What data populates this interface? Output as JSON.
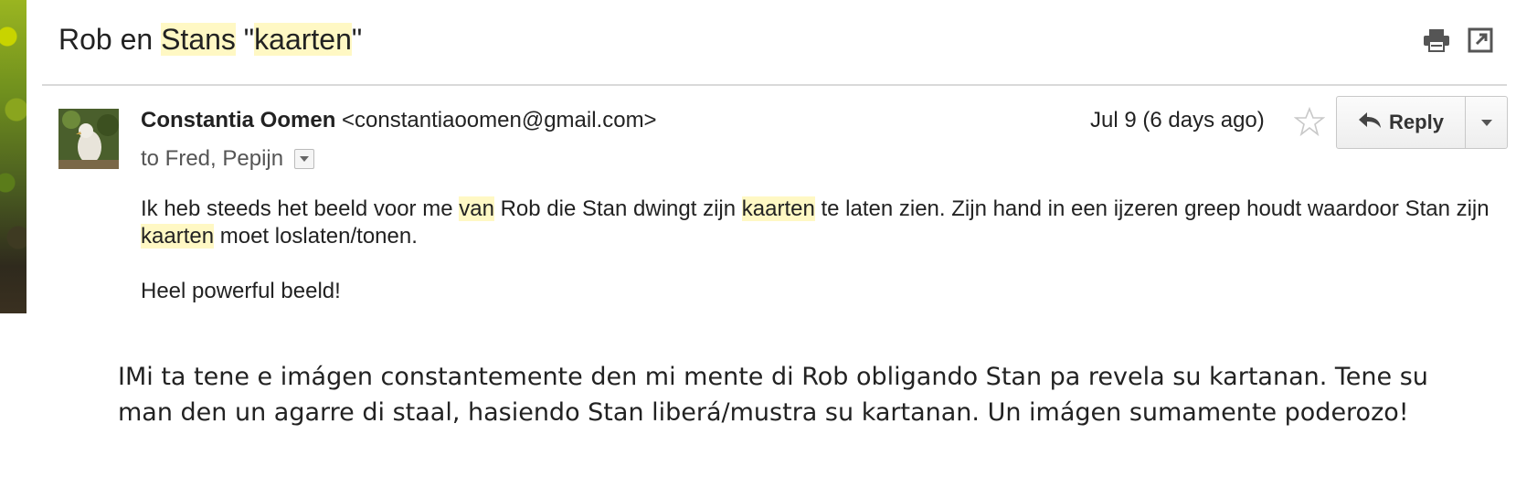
{
  "subject": {
    "part1": "Rob en ",
    "hl1": "Stans",
    "part2": " \"",
    "hl2": "kaarten",
    "part3": "\""
  },
  "toolbar": {
    "print_icon": "print-icon",
    "popout_icon": "new-window-icon"
  },
  "message": {
    "sender_name": "Constantia Oomen",
    "sender_email": "<constantiaoomen@gmail.com>",
    "to_text": "to Fred, Pepijn",
    "date": "Jul 9 (6 days ago)",
    "reply_label": "Reply",
    "body": {
      "l1a": "Ik heb steeds het beeld voor me ",
      "l1b": "van",
      "l1c": " Rob die Stan dwingt zijn ",
      "l1d": "kaarten",
      "l1e": " te laten zien. Zijn hand in een ijzeren greep houdt waardoor Stan zijn ",
      "l1f": "kaarten",
      "l1g": " moet loslaten/tonen.",
      "p2": "Heel powerful beeld!"
    }
  },
  "translation": "IMi ta tene e imágen constantemente den mi mente di Rob obligando Stan pa revela su kartanan. Tene su man den un agarre di staal, hasiendo Stan liberá/mustra su kartanan. Un imágen sumamente poderozo!",
  "colors": {
    "highlight": "#fff8c4",
    "divider": "#d9d9d9"
  }
}
